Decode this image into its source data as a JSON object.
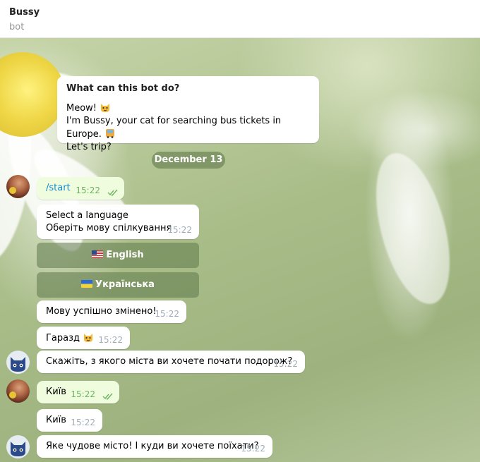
{
  "header": {
    "title": "Bussy",
    "subtitle": "bot"
  },
  "intro": {
    "title": "What can this bot do?",
    "line1": "Meow!",
    "line2": "I'm Bussy, your cat for searching bus tickets in Europe.",
    "line3": "Let's trip?"
  },
  "date_separator": "December 13",
  "messages": [
    {
      "text": "/start",
      "time": "15:22"
    },
    {
      "line1": "Select a language",
      "line2": "Оберіть мову спілкування",
      "time": "15:22"
    },
    {
      "text": "Мову успішно змінено!",
      "time": "15:22"
    },
    {
      "text": "Гаразд",
      "time": "15:22"
    },
    {
      "text": "Скажіть, з якого міста ви хочете почати подорож?",
      "time": "15:22"
    },
    {
      "text": "Київ",
      "time": "15:22"
    },
    {
      "text": "Київ",
      "time": "15:22"
    },
    {
      "text": "Яке чудове місто! І куди ви хочете поїхати?",
      "time": "15:22"
    }
  ],
  "keyboard": {
    "english": "English",
    "ukrainian": "Українська"
  },
  "colors": {
    "outgoing_bubble": "#effdde",
    "incoming_bubble": "#ffffff",
    "command_link": "#168acd",
    "check_marks": "#6cb562"
  }
}
